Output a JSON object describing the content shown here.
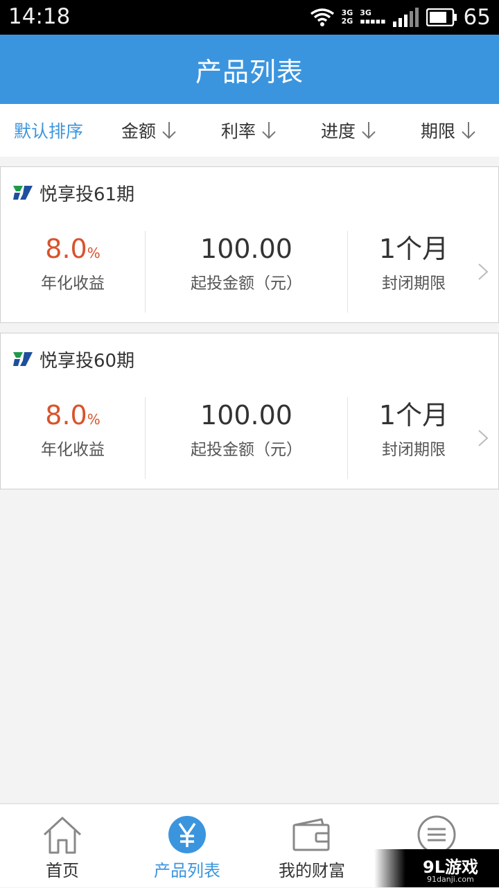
{
  "status_bar": {
    "time": "14:18",
    "network_top": "3G",
    "network_bottom": "2G",
    "network_top2": "3G",
    "battery": "65"
  },
  "header": {
    "title": "产品列表"
  },
  "sort_bar": {
    "items": [
      {
        "label": "默认排序",
        "active": true
      },
      {
        "label": "金额",
        "arrow": "arrow-down-icon"
      },
      {
        "label": "利率",
        "arrow": "arrow-down-icon"
      },
      {
        "label": "进度",
        "arrow": "arrow-down-icon"
      },
      {
        "label": "期限",
        "arrow": "arrow-down-icon"
      }
    ]
  },
  "products": [
    {
      "name": "悦享投61期",
      "rate": "8.0",
      "rate_unit": "%",
      "rate_label": "年化收益",
      "amount": "100.00",
      "amount_label": "起投金额（元）",
      "term": "1个月",
      "term_label": "封闭期限"
    },
    {
      "name": "悦享投60期",
      "rate": "8.0",
      "rate_unit": "%",
      "rate_label": "年化收益",
      "amount": "100.00",
      "amount_label": "起投金额（元）",
      "term": "1个月",
      "term_label": "封闭期限"
    }
  ],
  "tabs": [
    {
      "label": "首页",
      "icon": "home-icon"
    },
    {
      "label": "产品列表",
      "icon": "yen-icon",
      "active": true
    },
    {
      "label": "我的财富",
      "icon": "wallet-icon"
    },
    {
      "label": "",
      "icon": "menu-icon"
    }
  ],
  "colors": {
    "accent": "#3b95de",
    "rate": "#d9532c"
  },
  "watermark": {
    "brand": "9L游戏",
    "url": "91danji.com"
  }
}
